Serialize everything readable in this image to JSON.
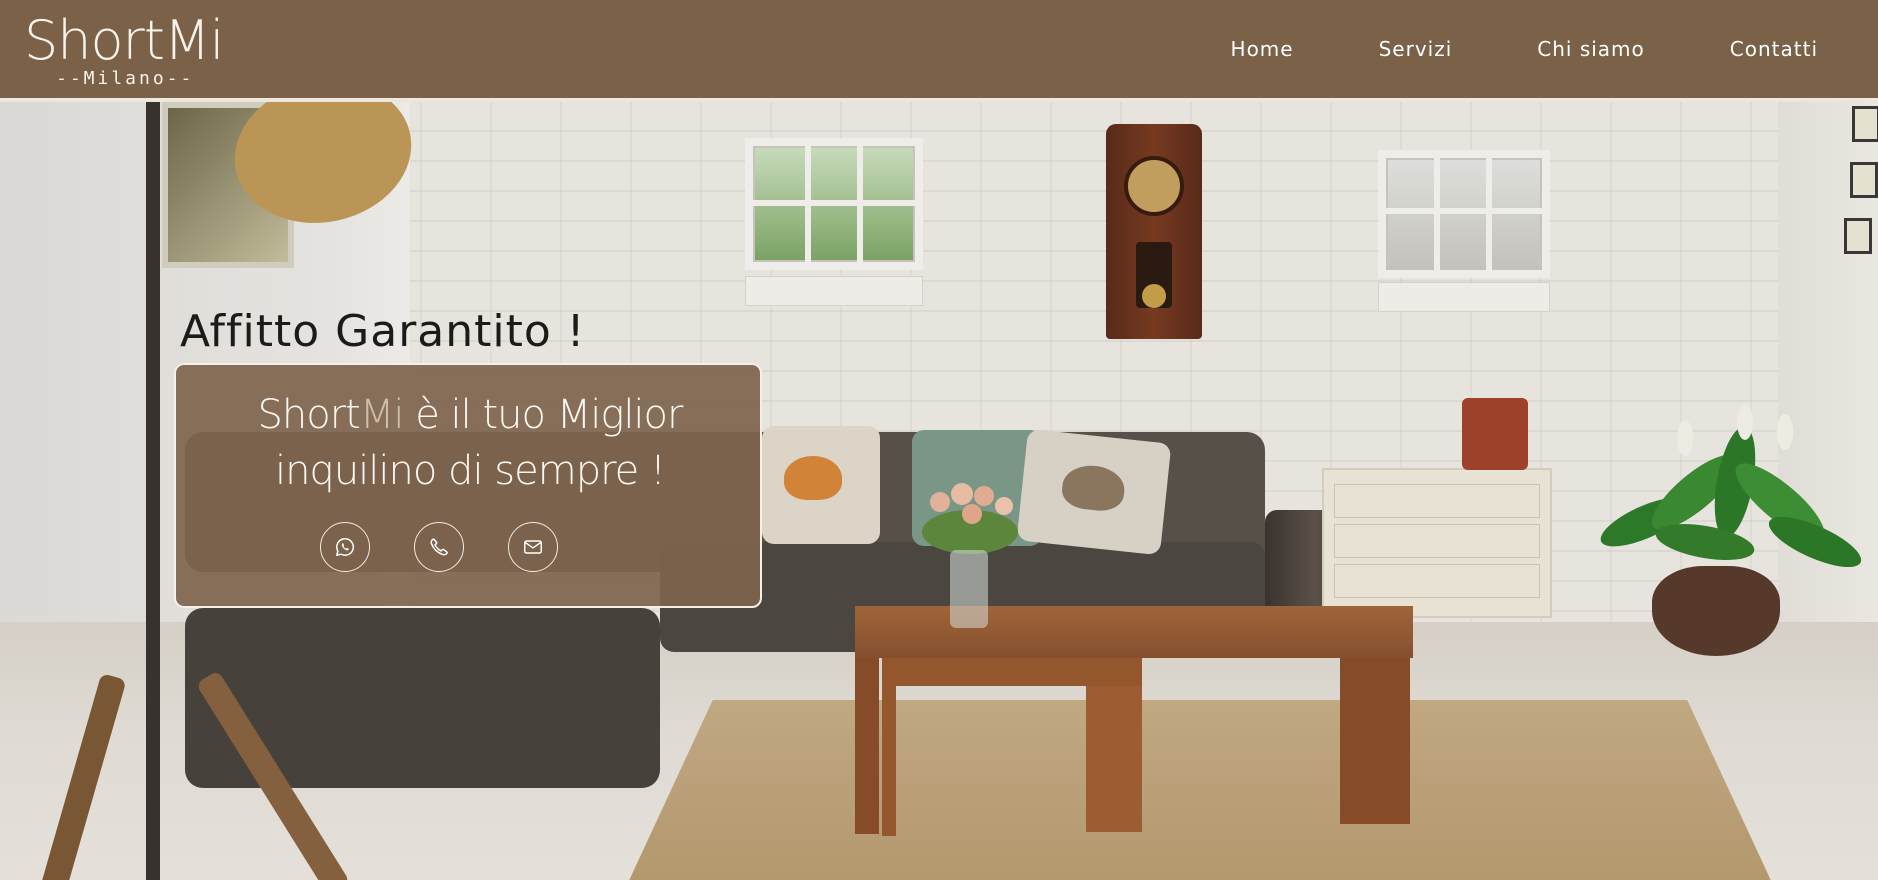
{
  "header": {
    "logo_main": "ShortMi",
    "logo_sub": "--Milano--",
    "nav": [
      {
        "label": "Home"
      },
      {
        "label": "Servizi"
      },
      {
        "label": "Chi siamo"
      },
      {
        "label": "Contatti"
      }
    ]
  },
  "hero": {
    "headline": "Affitto Garantito !",
    "card": {
      "brand_short": "Short",
      "brand_mi": "Mi",
      "tagline_rest": " è il tuo Miglior inquilino di sempre !",
      "contact_icons": [
        "whatsapp-icon",
        "phone-icon",
        "mail-icon"
      ]
    }
  },
  "colors": {
    "header_bg": "#7a6148",
    "card_bg": "#7e644d",
    "text_light": "#ffffff",
    "headline_text": "#1d1b19"
  }
}
